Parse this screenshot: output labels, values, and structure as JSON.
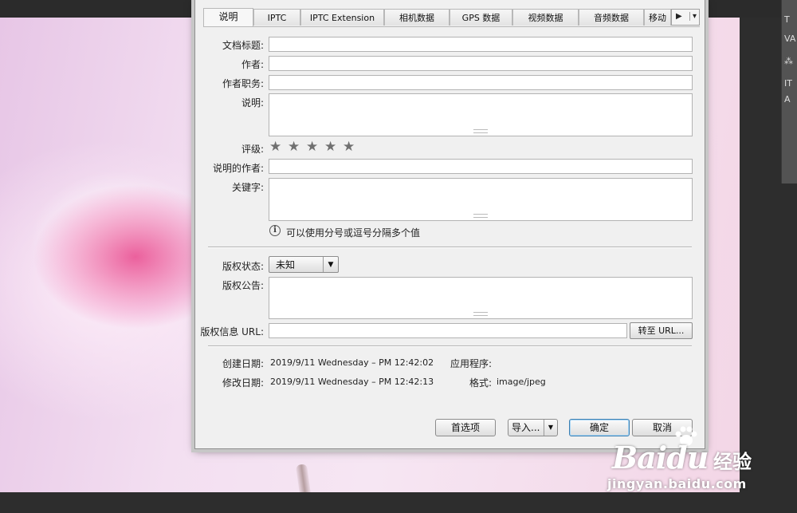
{
  "tabs": [
    {
      "label": "说明",
      "active": true
    },
    {
      "label": "IPTC"
    },
    {
      "label": "IPTC Extension"
    },
    {
      "label": "相机数据"
    },
    {
      "label": "GPS 数据"
    },
    {
      "label": "视频数据"
    },
    {
      "label": "音频数据"
    },
    {
      "label": "移动"
    }
  ],
  "tab_scroll": {
    "next_icon": "▶",
    "menu_icon": "▾"
  },
  "fields": {
    "doc_title": {
      "label": "文档标题:",
      "value": ""
    },
    "author": {
      "label": "作者:",
      "value": ""
    },
    "author_title": {
      "label": "作者职务:",
      "value": ""
    },
    "description": {
      "label": "说明:",
      "value": ""
    },
    "rating": {
      "label": "评级:",
      "stars": 0,
      "max": 5
    },
    "description_writer": {
      "label": "说明的作者:",
      "value": ""
    },
    "keywords": {
      "label": "关键字:",
      "value": "",
      "hint": "可以使用分号或逗号分隔多个值",
      "hint_icon": "i"
    }
  },
  "copyright": {
    "status_label": "版权状态:",
    "status_value": "未知",
    "notice_label": "版权公告:",
    "notice_value": "",
    "url_label": "版权信息 URL:",
    "url_value": "",
    "goto_button": "转至 URL..."
  },
  "file_info": {
    "created_label": "创建日期:",
    "created_value": "2019/9/11 Wednesday – PM 12:42:02",
    "modified_label": "修改日期:",
    "modified_value": "2019/9/11 Wednesday – PM 12:42:13",
    "application_label": "应用程序:",
    "application_value": "",
    "format_label": "格式:",
    "format_value": "image/jpeg"
  },
  "buttons": {
    "preferences": "首选项",
    "import": "导入...",
    "ok": "确定",
    "cancel": "取消"
  },
  "toolbar_right": [
    "T",
    "VA",
    "⁂",
    "IT",
    "A"
  ],
  "watermark": {
    "logo": "Baidu",
    "cn": "经验",
    "url": "jingyan.baidu.com"
  },
  "colors": {
    "accent": "#3c7fb1",
    "dialog_bg": "#f0f0f0",
    "star": "#707070"
  }
}
